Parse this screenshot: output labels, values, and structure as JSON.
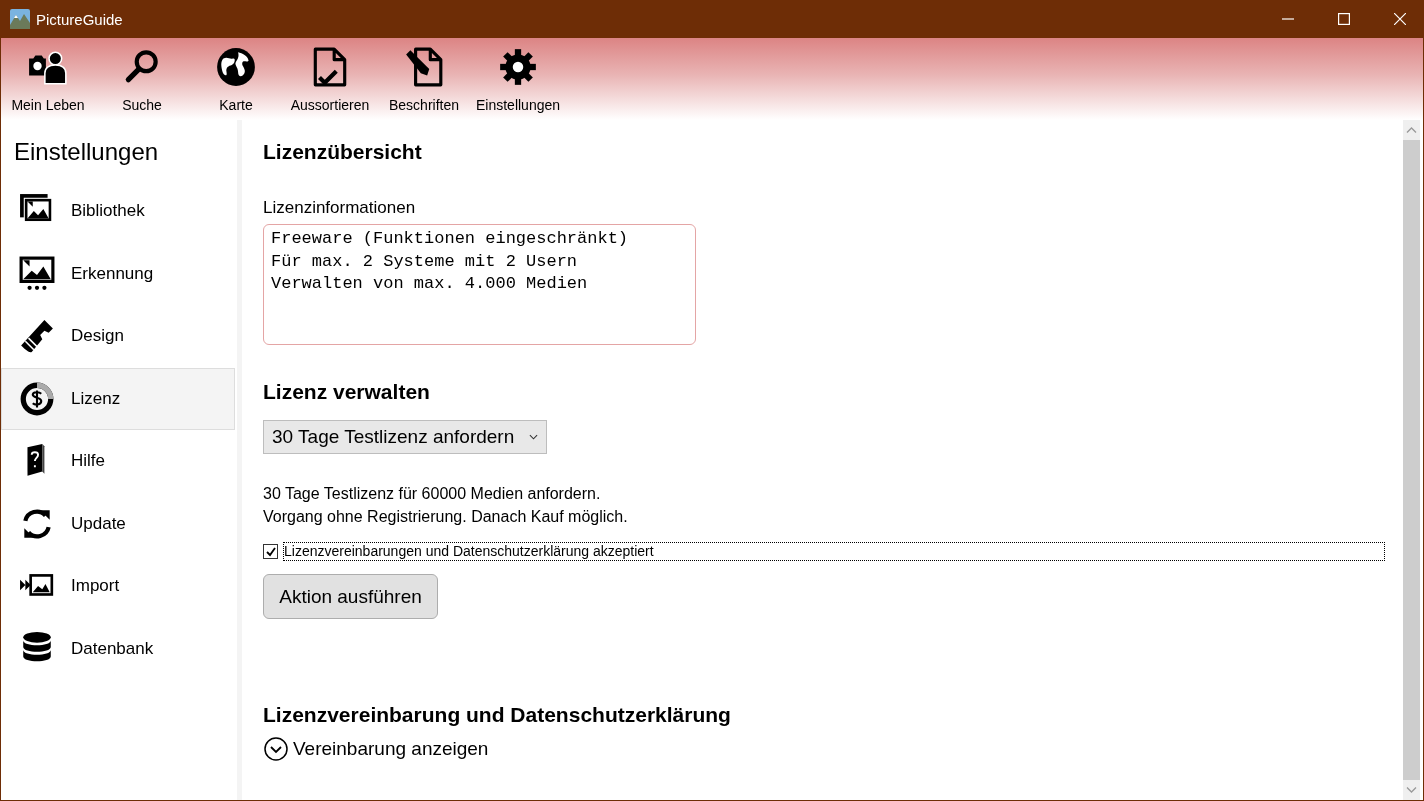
{
  "window": {
    "title": "PictureGuide"
  },
  "toolbar": [
    {
      "label": "Mein Leben"
    },
    {
      "label": "Suche"
    },
    {
      "label": "Karte"
    },
    {
      "label": "Aussortieren"
    },
    {
      "label": "Beschriften"
    },
    {
      "label": "Einstellungen"
    }
  ],
  "sidebar": {
    "title": "Einstellungen",
    "items": [
      {
        "label": "Bibliothek",
        "selected": false
      },
      {
        "label": "Erkennung",
        "selected": false
      },
      {
        "label": "Design",
        "selected": false
      },
      {
        "label": "Lizenz",
        "selected": true
      },
      {
        "label": "Hilfe",
        "selected": false
      },
      {
        "label": "Update",
        "selected": false
      },
      {
        "label": "Import",
        "selected": false
      },
      {
        "label": "Datenbank",
        "selected": false
      }
    ]
  },
  "content": {
    "overview_heading": "Lizenzübersicht",
    "license_info": {
      "label": "Lizenzinformationen",
      "value": "Freeware (Funktionen eingeschränkt)\nFür max. 2 Systeme mit 2 Usern\nVerwalten von max. 4.000 Medien"
    },
    "manage_heading": "Lizenz verwalten",
    "action_dropdown": {
      "value": "30 Tage Testlizenz anfordern"
    },
    "description": [
      "30 Tage Testlizenz für 60000 Medien anfordern.",
      "Vorgang ohne Registrierung. Danach Kauf möglich."
    ],
    "accept_checkbox": {
      "label": "Lizenzvereinbarungen und Datenschutzerklärung akzeptiert",
      "checked": true,
      "focused": true
    },
    "action_button": "Aktion ausführen",
    "agreement_heading": "Lizenzvereinbarung und Datenschutzerklärung",
    "agreement_expander": {
      "label": "Vereinbarung anzeigen",
      "expanded": false
    }
  }
}
